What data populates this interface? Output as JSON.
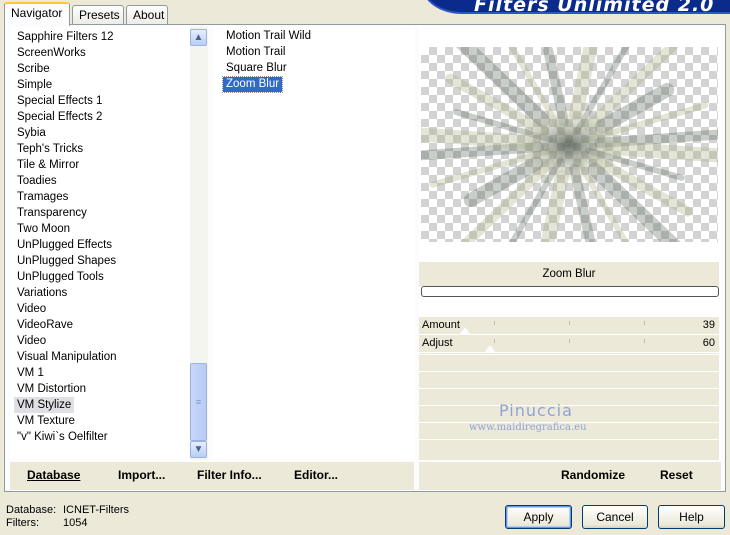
{
  "tabs": [
    {
      "label": "Navigator",
      "active": true
    },
    {
      "label": "Presets",
      "active": false
    },
    {
      "label": "About",
      "active": false
    }
  ],
  "banner_title": "Filters Unlimited 2.0",
  "categories": [
    "Sapphire Filters 12",
    "ScreenWorks",
    "Scribe",
    "Simple",
    "Special Effects 1",
    "Special Effects 2",
    "Sybia",
    "Teph's Tricks",
    "Tile & Mirror",
    "Toadies",
    "Tramages",
    "Transparency",
    "Two Moon",
    "UnPlugged Effects",
    "UnPlugged Shapes",
    "UnPlugged Tools",
    "Variations",
    "Video",
    "VideoRave",
    "Video",
    "Visual Manipulation",
    "VM 1",
    "VM Distortion",
    "VM Stylize",
    "VM Texture",
    "\"v\" Kiwi`s Oelfilter"
  ],
  "selected_category": "VM Stylize",
  "filters": [
    "Motion Trail Wild",
    "Motion Trail",
    "Square Blur",
    "Zoom Blur"
  ],
  "selected_filter": "Zoom Blur",
  "preview": {
    "filter_name": "Zoom Blur",
    "progress": 0.0,
    "watermark_name": "Pinuccia",
    "watermark_site": "www.maidiregrafica.eu"
  },
  "parameters": [
    {
      "label": "Amount",
      "value": "39",
      "level": 0.153
    },
    {
      "label": "Adjust",
      "value": "60",
      "level": 0.235
    }
  ],
  "toolbar": {
    "database": "Database",
    "import": "Import...",
    "filter_info": "Filter Info...",
    "editor": "Editor...",
    "randomize": "Randomize",
    "reset": "Reset"
  },
  "status": {
    "database_label": "Database:",
    "database_value": "ICNET-Filters",
    "filters_label": "Filters:",
    "filters_value": "1054"
  },
  "buttons": {
    "apply": "Apply",
    "cancel": "Cancel",
    "help": "Help"
  },
  "icons": {
    "scroll_up": "chevron-up-icon",
    "scroll_thumb": "grip-icon"
  },
  "colors": {
    "selection": "#316ac5",
    "banner": "#0a2a8c",
    "dialog_bg": "#ece9d8"
  }
}
